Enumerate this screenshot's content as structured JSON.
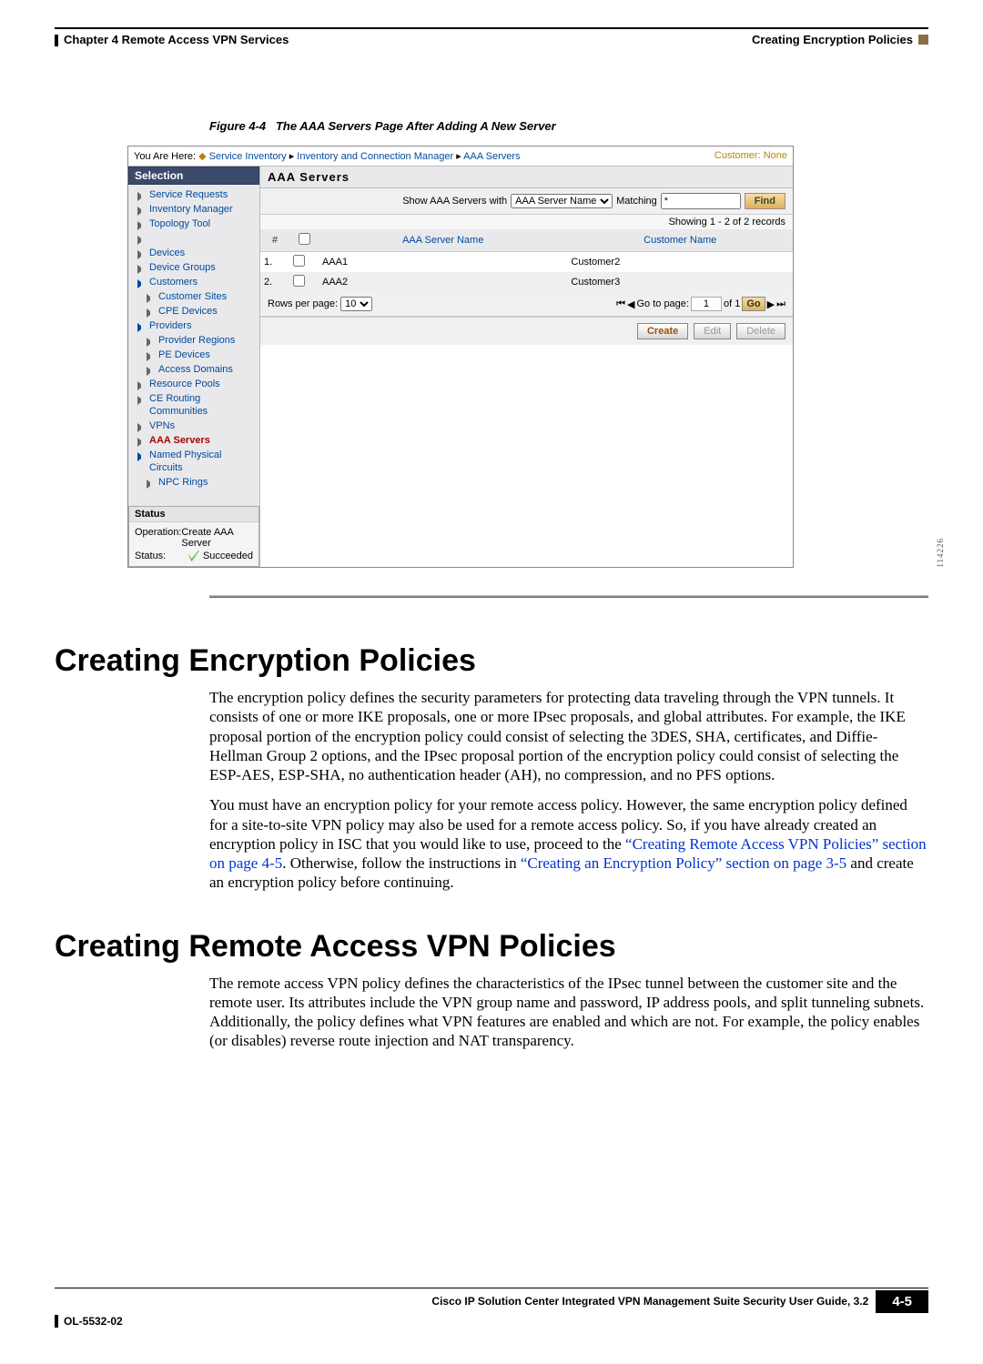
{
  "header": {
    "chapter": "Chapter 4    Remote Access VPN Services",
    "section_right": "Creating Encryption Policies"
  },
  "figure": {
    "label": "Figure 4-4",
    "title": "The AAA Servers Page After Adding A New Server",
    "side_number": "114226"
  },
  "breadcrumb": {
    "prefix": "You Are Here: ",
    "items": [
      "Service Inventory",
      "Inventory and Connection Manager",
      "AAA Servers"
    ],
    "customer_label": "Customer:",
    "customer_value": "None"
  },
  "panel_title": "AAA Servers",
  "sidebar": {
    "selection_label": "Selection",
    "items": [
      {
        "label": "Service Requests",
        "type": "arrow"
      },
      {
        "label": "Inventory Manager",
        "type": "arrow"
      },
      {
        "label": "Topology Tool",
        "type": "arrow"
      },
      {
        "label": "",
        "type": "arrow"
      },
      {
        "label": "Devices",
        "type": "arrow"
      },
      {
        "label": "Device Groups",
        "type": "arrow"
      },
      {
        "label": "Customers",
        "type": "chev",
        "children": [
          {
            "label": "Customer Sites"
          },
          {
            "label": "CPE Devices"
          }
        ]
      },
      {
        "label": "Providers",
        "type": "chev",
        "children": [
          {
            "label": "Provider Regions"
          },
          {
            "label": "PE Devices"
          },
          {
            "label": "Access Domains"
          }
        ]
      },
      {
        "label": "Resource Pools",
        "type": "arrow"
      },
      {
        "label": "CE Routing Communities",
        "type": "arrow"
      },
      {
        "label": "VPNs",
        "type": "arrow"
      },
      {
        "label": "AAA Servers",
        "type": "arrow",
        "active": true
      },
      {
        "label": "Named Physical Circuits",
        "type": "chev",
        "children": [
          {
            "label": "NPC Rings"
          }
        ]
      }
    ],
    "status": {
      "header": "Status",
      "operation_label": "Operation:",
      "operation_value": "Create AAA Server",
      "status_label": "Status:",
      "status_value": "Succeeded"
    }
  },
  "toolbar": {
    "show_label": "Show AAA Servers with",
    "filter_options": [
      "AAA Server Name"
    ],
    "matching_label": "Matching",
    "matching_value": "*",
    "find_label": "Find"
  },
  "records_info": "Showing 1 - 2 of 2 records",
  "table": {
    "col_num": "#",
    "col_name": "AAA Server Name",
    "col_cust": "Customer Name",
    "rows": [
      {
        "n": "1.",
        "name": "AAA1",
        "cust": "Customer2"
      },
      {
        "n": "2.",
        "name": "AAA2",
        "cust": "Customer3"
      }
    ]
  },
  "pager": {
    "rows_label": "Rows per page:",
    "rows_value": "10",
    "goto_label": "Go to page:",
    "goto_value": "1",
    "of_label": "of 1",
    "go_label": "Go"
  },
  "actions": {
    "create": "Create",
    "edit": "Edit",
    "delete": "Delete"
  },
  "sections": {
    "s1_title": "Creating Encryption Policies",
    "s1_p1": "The encryption policy defines the security parameters for protecting data traveling through the VPN tunnels. It consists of one or more IKE proposals, one or more IPsec proposals, and global attributes. For example, the IKE proposal portion of the encryption policy could consist of selecting the 3DES, SHA, certificates, and Diffie-Hellman Group 2 options, and the IPsec proposal portion of the encryption policy could consist of selecting the ESP-AES, ESP-SHA, no authentication header (AH), no compression, and no PFS options.",
    "s1_p2a": "You must have an encryption policy for your remote access policy. However, the same encryption policy defined for a site-to-site VPN policy may also be used for a remote access policy. So, if you have already created an encryption policy in ISC that you would like to use, proceed to the ",
    "s1_link1": "“Creating Remote Access VPN Policies” section on page 4-5",
    "s1_p2b": ". Otherwise, follow the instructions in ",
    "s1_link2": "“Creating an Encryption Policy” section on page 3-5",
    "s1_p2c": " and create an encryption policy before continuing.",
    "s2_title": "Creating Remote Access VPN Policies",
    "s2_p1": "The remote access VPN policy defines the characteristics of the IPsec tunnel between the customer site and the remote user. Its attributes include the VPN group name and password, IP address pools, and split tunneling subnets. Additionally, the policy defines what VPN features are enabled and which are not. For example, the policy enables (or disables) reverse route injection and NAT transparency."
  },
  "footer": {
    "guide": "Cisco IP Solution Center Integrated VPN Management Suite Security User Guide, 3.2",
    "page": "4-5",
    "docnum": "OL-5532-02"
  }
}
